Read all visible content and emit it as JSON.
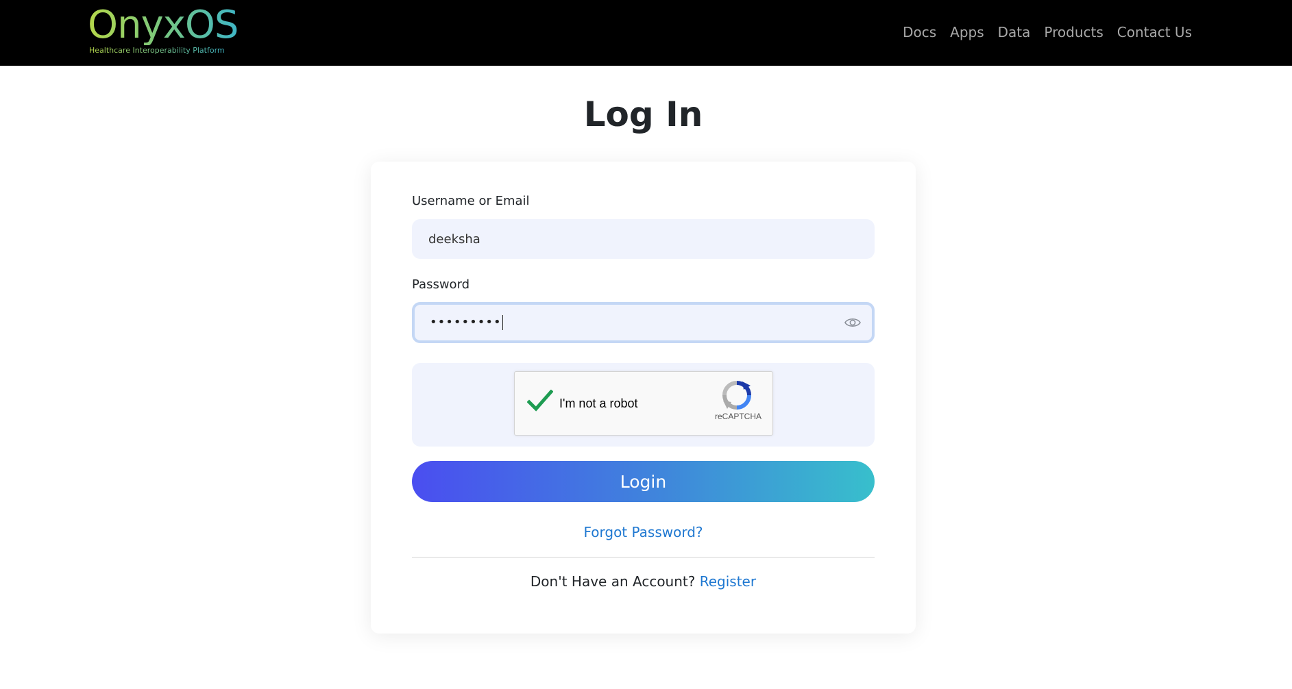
{
  "brand": {
    "name": "OnyxOS",
    "tagline": "Healthcare Interoperability Platform"
  },
  "nav": {
    "links": [
      "Docs",
      "Apps",
      "Data",
      "Products",
      "Contact Us"
    ]
  },
  "page": {
    "title": "Log In"
  },
  "form": {
    "username_label": "Username or Email",
    "username_value": "deeksha",
    "password_label": "Password",
    "password_masked": "•••••••••",
    "captcha_label": "I'm not a robot",
    "captcha_brand": "reCAPTCHA",
    "login_label": "Login",
    "forgot_label": "Forgot Password?",
    "no_account_text": "Don't Have an Account?",
    "register_label": "Register"
  },
  "colors": {
    "navbar_bg": "#000000",
    "input_bg": "#f0f3fd",
    "link": "#1f78d1",
    "button_gradient_start": "#4a4ef0",
    "button_gradient_end": "#38bfcc",
    "check_green": "#1e9c52"
  },
  "icons": {
    "password_toggle": "eye-icon",
    "captcha_check": "checkmark-icon",
    "captcha_logo": "recaptcha-logo-icon"
  }
}
